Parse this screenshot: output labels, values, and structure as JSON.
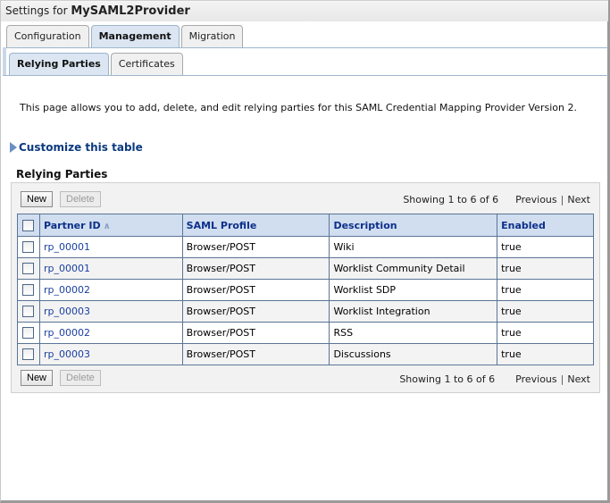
{
  "header": {
    "title_prefix": "Settings for ",
    "title_name": "MySAML2Provider"
  },
  "tabs": [
    {
      "label": "Configuration",
      "active": false
    },
    {
      "label": "Management",
      "active": true
    },
    {
      "label": "Migration",
      "active": false
    }
  ],
  "subtabs": [
    {
      "label": "Relying Parties",
      "active": true
    },
    {
      "label": "Certificates",
      "active": false
    }
  ],
  "intro_text": "This page allows you to add, delete, and edit relying parties for this SAML Credential Mapping Provider Version 2.",
  "customize_label": "Customize this table",
  "section_title": "Relying Parties",
  "toolbar": {
    "new_label": "New",
    "delete_label": "Delete",
    "showing": "Showing 1 to 6 of 6",
    "previous": "Previous",
    "next": "Next"
  },
  "table": {
    "columns": [
      "Partner ID",
      "SAML Profile",
      "Description",
      "Enabled"
    ],
    "sort_icon": "sort-ascending-icon",
    "rows": [
      {
        "partner_id": "rp_00001",
        "profile": "Browser/POST",
        "description": "Wiki",
        "enabled": "true"
      },
      {
        "partner_id": "rp_00001",
        "profile": "Browser/POST",
        "description": "Worklist Community Detail",
        "enabled": "true"
      },
      {
        "partner_id": "rp_00002",
        "profile": "Browser/POST",
        "description": "Worklist SDP",
        "enabled": "true"
      },
      {
        "partner_id": "rp_00003",
        "profile": "Browser/POST",
        "description": "Worklist Integration",
        "enabled": "true"
      },
      {
        "partner_id": "rp_00002",
        "profile": "Browser/POST",
        "description": "RSS",
        "enabled": "true"
      },
      {
        "partner_id": "rp_00003",
        "profile": "Browser/POST",
        "description": "Discussions",
        "enabled": "true"
      }
    ]
  },
  "colors": {
    "header_link": "#0c2f8a",
    "link": "#1a3fa0",
    "table_header_bg": "#d1def0",
    "active_tab_bg": "#dbe6f2"
  }
}
